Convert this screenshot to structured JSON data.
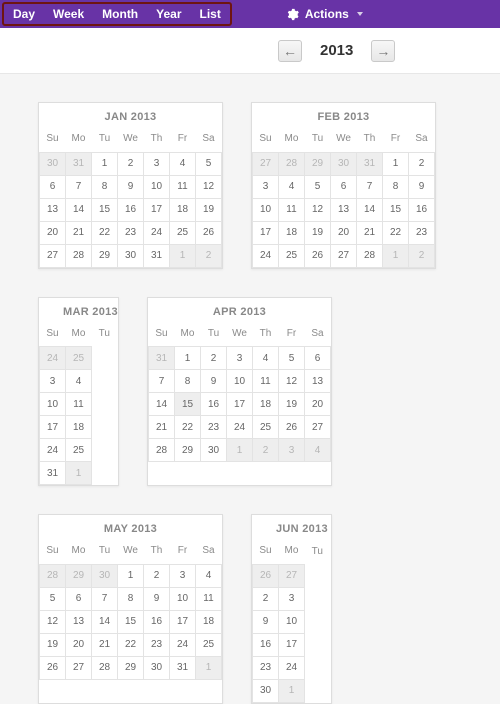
{
  "toolbar": {
    "tabs": [
      "Day",
      "Week",
      "Month",
      "Year",
      "List"
    ],
    "actions_label": "Actions"
  },
  "nav": {
    "year": "2013",
    "prev_glyph": "←",
    "next_glyph": "→"
  },
  "dow": [
    "Su",
    "Mo",
    "Tu",
    "We",
    "Th",
    "Fr",
    "Sa"
  ],
  "months": [
    {
      "title": "JAN 2013",
      "rows": [
        [
          {
            "n": 30,
            "c": "dim"
          },
          {
            "n": 31,
            "c": "dim"
          },
          {
            "n": 1
          },
          {
            "n": 2
          },
          {
            "n": 3
          },
          {
            "n": 4
          },
          {
            "n": 5
          }
        ],
        [
          {
            "n": 6
          },
          {
            "n": 7
          },
          {
            "n": 8
          },
          {
            "n": 9
          },
          {
            "n": 10
          },
          {
            "n": 11
          },
          {
            "n": 12
          }
        ],
        [
          {
            "n": 13
          },
          {
            "n": 14
          },
          {
            "n": 15
          },
          {
            "n": 16
          },
          {
            "n": 17
          },
          {
            "n": 18
          },
          {
            "n": 19
          }
        ],
        [
          {
            "n": 20
          },
          {
            "n": 21
          },
          {
            "n": 22
          },
          {
            "n": 23
          },
          {
            "n": 24
          },
          {
            "n": 25
          },
          {
            "n": 26
          }
        ],
        [
          {
            "n": 27
          },
          {
            "n": 28
          },
          {
            "n": 29
          },
          {
            "n": 30
          },
          {
            "n": 31
          },
          {
            "n": 1,
            "c": "dim"
          },
          {
            "n": 2,
            "c": "dim"
          }
        ]
      ]
    },
    {
      "title": "FEB 2013",
      "rows": [
        [
          {
            "n": 27,
            "c": "dim"
          },
          {
            "n": 28,
            "c": "dim"
          },
          {
            "n": 29,
            "c": "dim"
          },
          {
            "n": 30,
            "c": "dim"
          },
          {
            "n": 31,
            "c": "dim"
          },
          {
            "n": 1
          },
          {
            "n": 2
          }
        ],
        [
          {
            "n": 3
          },
          {
            "n": 4
          },
          {
            "n": 5
          },
          {
            "n": 6
          },
          {
            "n": 7
          },
          {
            "n": 8
          },
          {
            "n": 9
          }
        ],
        [
          {
            "n": 10
          },
          {
            "n": 11
          },
          {
            "n": 12
          },
          {
            "n": 13
          },
          {
            "n": 14
          },
          {
            "n": 15
          },
          {
            "n": 16
          }
        ],
        [
          {
            "n": 17
          },
          {
            "n": 18
          },
          {
            "n": 19
          },
          {
            "n": 20
          },
          {
            "n": 21
          },
          {
            "n": 22
          },
          {
            "n": 23
          }
        ],
        [
          {
            "n": 24
          },
          {
            "n": 25
          },
          {
            "n": 26
          },
          {
            "n": 27
          },
          {
            "n": 28
          },
          {
            "n": 1,
            "c": "dim"
          },
          {
            "n": 2,
            "c": "dim"
          }
        ]
      ]
    },
    {
      "title": "MAR 2013",
      "clip": true,
      "rows": [
        [
          {
            "n": 24,
            "c": "dim"
          },
          {
            "n": 25,
            "c": "dim"
          },
          {
            "n": ""
          }
        ],
        [
          {
            "n": 3
          },
          {
            "n": 4
          },
          {
            "n": ""
          }
        ],
        [
          {
            "n": 10
          },
          {
            "n": 11
          },
          {
            "n": ""
          }
        ],
        [
          {
            "n": 17
          },
          {
            "n": 18
          },
          {
            "n": ""
          }
        ],
        [
          {
            "n": 24
          },
          {
            "n": 25
          },
          {
            "n": ""
          }
        ],
        [
          {
            "n": 31
          },
          {
            "n": 1,
            "c": "dim"
          },
          {
            "n": ""
          }
        ]
      ]
    },
    {
      "title": "APR 2013",
      "rows": [
        [
          {
            "n": 31,
            "c": "dim"
          },
          {
            "n": 1
          },
          {
            "n": 2
          },
          {
            "n": 3
          },
          {
            "n": 4
          },
          {
            "n": 5
          },
          {
            "n": 6
          }
        ],
        [
          {
            "n": 7
          },
          {
            "n": 8
          },
          {
            "n": 9
          },
          {
            "n": 10
          },
          {
            "n": 11
          },
          {
            "n": 12
          },
          {
            "n": 13
          }
        ],
        [
          {
            "n": 14
          },
          {
            "n": 15,
            "c": "shade"
          },
          {
            "n": 16
          },
          {
            "n": 17
          },
          {
            "n": 18
          },
          {
            "n": 19
          },
          {
            "n": 20
          }
        ],
        [
          {
            "n": 21
          },
          {
            "n": 22
          },
          {
            "n": 23
          },
          {
            "n": 24
          },
          {
            "n": 25
          },
          {
            "n": 26
          },
          {
            "n": 27
          }
        ],
        [
          {
            "n": 28
          },
          {
            "n": 29
          },
          {
            "n": 30
          },
          {
            "n": 1,
            "c": "dim"
          },
          {
            "n": 2,
            "c": "dim"
          },
          {
            "n": 3,
            "c": "dim"
          },
          {
            "n": 4,
            "c": "dim"
          }
        ]
      ]
    },
    {
      "title": "MAY 2013",
      "rows": [
        [
          {
            "n": 28,
            "c": "dim"
          },
          {
            "n": 29,
            "c": "dim"
          },
          {
            "n": 30,
            "c": "dim"
          },
          {
            "n": 1
          },
          {
            "n": 2
          },
          {
            "n": 3
          },
          {
            "n": 4
          }
        ],
        [
          {
            "n": 5
          },
          {
            "n": 6
          },
          {
            "n": 7
          },
          {
            "n": 8
          },
          {
            "n": 9
          },
          {
            "n": 10
          },
          {
            "n": 11
          }
        ],
        [
          {
            "n": 12
          },
          {
            "n": 13
          },
          {
            "n": 14
          },
          {
            "n": 15
          },
          {
            "n": 16
          },
          {
            "n": 17
          },
          {
            "n": 18
          }
        ],
        [
          {
            "n": 19
          },
          {
            "n": 20
          },
          {
            "n": 21
          },
          {
            "n": 22
          },
          {
            "n": 23
          },
          {
            "n": 24
          },
          {
            "n": 25
          }
        ],
        [
          {
            "n": 26
          },
          {
            "n": 27
          },
          {
            "n": 28
          },
          {
            "n": 29
          },
          {
            "n": 30
          },
          {
            "n": 31
          },
          {
            "n": 1,
            "c": "dim"
          }
        ]
      ]
    },
    {
      "title": "JUN 2013",
      "clip": true,
      "rows": [
        [
          {
            "n": 26,
            "c": "dim"
          },
          {
            "n": 27,
            "c": "dim"
          },
          {
            "n": ""
          }
        ],
        [
          {
            "n": 2
          },
          {
            "n": 3
          },
          {
            "n": ""
          }
        ],
        [
          {
            "n": 9
          },
          {
            "n": 10
          },
          {
            "n": ""
          }
        ],
        [
          {
            "n": 16
          },
          {
            "n": 17
          },
          {
            "n": ""
          }
        ],
        [
          {
            "n": 23
          },
          {
            "n": 24
          },
          {
            "n": ""
          }
        ],
        [
          {
            "n": 30
          },
          {
            "n": 1,
            "c": "dim"
          },
          {
            "n": ""
          }
        ]
      ]
    }
  ]
}
